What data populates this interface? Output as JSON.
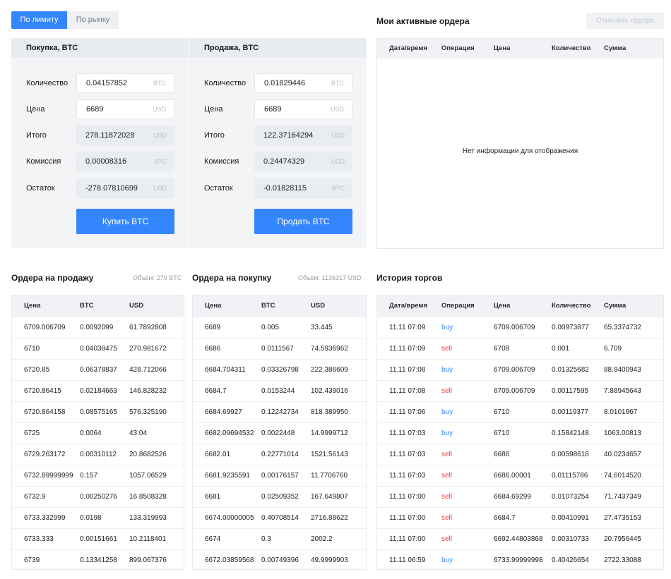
{
  "tabs": {
    "limit": "По лимиту",
    "market": "По рынку"
  },
  "buy_form": {
    "title": "Покупка, BTC",
    "rows": [
      {
        "label": "Количество",
        "value": "0.04157852",
        "currency": "BTC",
        "editable": true
      },
      {
        "label": "Цена",
        "value": "6689",
        "currency": "USD",
        "editable": true
      },
      {
        "label": "Итого",
        "value": "278.11872028",
        "currency": "USD",
        "editable": false
      },
      {
        "label": "Комиссия",
        "value": "0.00008316",
        "currency": "BTC",
        "editable": false
      },
      {
        "label": "Остаток",
        "value": "-278.07810699",
        "currency": "USD",
        "editable": false
      }
    ],
    "button": "Купить BTC"
  },
  "sell_form": {
    "title": "Продажа, BTC",
    "rows": [
      {
        "label": "Количество",
        "value": "0.01829446",
        "currency": "BTC",
        "editable": true
      },
      {
        "label": "Цена",
        "value": "6689",
        "currency": "USD",
        "editable": true
      },
      {
        "label": "Итого",
        "value": "122.37164294",
        "currency": "USD",
        "editable": false
      },
      {
        "label": "Комиссия",
        "value": "0.24474329",
        "currency": "USD",
        "editable": false
      },
      {
        "label": "Остаток",
        "value": "-0.01828115",
        "currency": "BTC",
        "editable": false
      }
    ],
    "button": "Продать BTC"
  },
  "active_orders": {
    "title": "Мои активные ордера",
    "cancel_button": "Отменить ордера",
    "columns": [
      "Дата/время",
      "Операция",
      "Цена",
      "Количество",
      "Сумма"
    ],
    "empty_message": "Нет информации для отображения"
  },
  "sell_orders": {
    "title": "Ордера на продажу",
    "volume": "Объём: 279 BTC",
    "columns": [
      "Цена",
      "BTC",
      "USD"
    ],
    "rows": [
      [
        "6709.006709",
        "0.0092099",
        "61.7892808"
      ],
      [
        "6710",
        "0.04038475",
        "270.981672"
      ],
      [
        "6720.85",
        "0.06378837",
        "428.712066"
      ],
      [
        "6720.86415",
        "0.02184663",
        "146.828232"
      ],
      [
        "6720.864158",
        "0.08575165",
        "576.325190"
      ],
      [
        "6725",
        "0.0064",
        "43.04"
      ],
      [
        "6729.263172",
        "0.00310112",
        "20.8682526"
      ],
      [
        "6732.89999999",
        "0.157",
        "1057.06529"
      ],
      [
        "6732.9",
        "0.00250276",
        "16.8508328"
      ],
      [
        "6733.332999",
        "0.0198",
        "133.319993"
      ],
      [
        "6733.333",
        "0.00151661",
        "10.2118401"
      ],
      [
        "6739",
        "0.13341258",
        "899.067376"
      ]
    ]
  },
  "buy_orders": {
    "title": "Ордера на покупку",
    "volume": "Объём: 1136317 USD",
    "columns": [
      "Цена",
      "BTC",
      "USD"
    ],
    "rows": [
      [
        "6689",
        "0.005",
        "33.445"
      ],
      [
        "6686",
        "0.0111567",
        "74.5936962"
      ],
      [
        "6684.704311",
        "0.03326798",
        "222.386609"
      ],
      [
        "6684.7",
        "0.0153244",
        "102.439016"
      ],
      [
        "6684.69927",
        "0.12242734",
        "818.389950"
      ],
      [
        "6682.09694532",
        "0.0022448",
        "14.9999712"
      ],
      [
        "6682.01",
        "0.22771014",
        "1521.56143"
      ],
      [
        "6681.9235591",
        "0.00176157",
        "11.7706760"
      ],
      [
        "6681",
        "0.02509352",
        "167.649807"
      ],
      [
        "6674.00000005",
        "0.40708514",
        "2716.88622"
      ],
      [
        "6674",
        "0.3",
        "2002.2"
      ],
      [
        "6672.03859568",
        "0.00749396",
        "49.9999903"
      ]
    ]
  },
  "trade_history": {
    "title": "История торгов",
    "columns": [
      "Дата/время",
      "Операция",
      "Цена",
      "Количество",
      "Сумма"
    ],
    "rows": [
      [
        "11.11 07:09",
        "buy",
        "6709.006709",
        "0.00973877",
        "65.3374732"
      ],
      [
        "11.11 07:09",
        "sell",
        "6709",
        "0.001",
        "6.709"
      ],
      [
        "11.11 07:08",
        "buy",
        "6709.006709",
        "0.01325682",
        "88.9400943"
      ],
      [
        "11.11 07:08",
        "sell",
        "6709.006709",
        "0.00117595",
        "7.88945643"
      ],
      [
        "11.11 07:06",
        "buy",
        "6710",
        "0.00119377",
        "8.0101967"
      ],
      [
        "11.11 07:03",
        "buy",
        "6710",
        "0.15842148",
        "1063.00813"
      ],
      [
        "11.11 07:03",
        "sell",
        "6686",
        "0.00598616",
        "40.0234657"
      ],
      [
        "11.11 07:03",
        "sell",
        "6686.00001",
        "0.01115786",
        "74.6014520"
      ],
      [
        "11.11 07:00",
        "sell",
        "6684.69299",
        "0.01073254",
        "71.7437349"
      ],
      [
        "11.11 07:00",
        "sell",
        "6684.7",
        "0.00410991",
        "27.4735153"
      ],
      [
        "11.11 07:00",
        "sell",
        "6692.44803868",
        "0.00310733",
        "20.7956445"
      ],
      [
        "11.11 06:59",
        "buy",
        "6733.99999998",
        "0.40426654",
        "2722.33088"
      ]
    ]
  },
  "colors": {
    "accent": "#3486ff",
    "buy": "#3486ff",
    "sell": "#ef3b3b",
    "panel_bg": "#f2f4f6"
  }
}
